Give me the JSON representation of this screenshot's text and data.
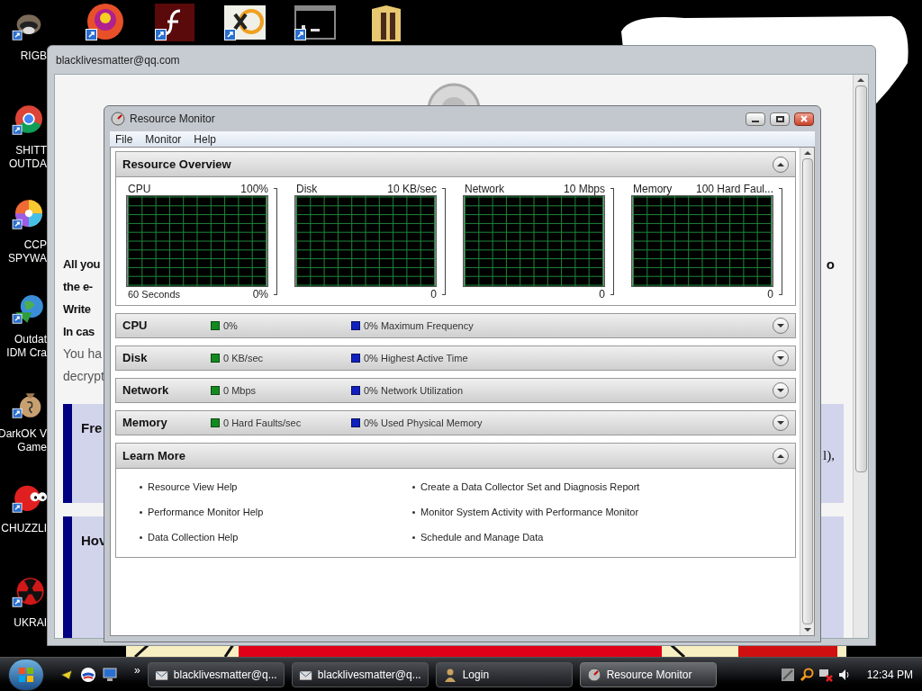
{
  "desktop_icons_left": [
    {
      "kind": "raccoon",
      "label": [
        "RIGB"
      ]
    },
    {
      "kind": "chrome",
      "label": [
        "SHITT",
        "OUTDA"
      ]
    },
    {
      "kind": "pinwheel",
      "label": [
        "CCP",
        "SPYWA"
      ]
    },
    {
      "kind": "globe",
      "label": [
        "Outdat",
        "IDM Cra"
      ]
    },
    {
      "kind": "moneybag",
      "label": [
        "DarkOK V",
        "Game"
      ]
    },
    {
      "kind": "furball",
      "label": [
        "CHUZZLI"
      ]
    },
    {
      "kind": "radiation",
      "label": [
        "UKRAI"
      ]
    }
  ],
  "desktop_icons_top": [
    {
      "kind": "ball"
    },
    {
      "kind": "flash"
    },
    {
      "kind": "hexeditor"
    },
    {
      "kind": "console"
    },
    {
      "kind": "folder"
    }
  ],
  "background_window": {
    "title": "blacklivesmatter@qq.com",
    "lines": [
      {
        "text": "All you",
        "kind": "heading"
      },
      {
        "text": "the e-",
        "kind": "heading"
      },
      {
        "text": "Write",
        "kind": "heading"
      },
      {
        "text": "In cas",
        "kind": "heading"
      },
      {
        "text": "You ha",
        "kind": "body"
      },
      {
        "text": "decrypt",
        "kind": "body"
      }
    ],
    "right_fragment": "o",
    "boxes": [
      {
        "heading": "Fre",
        "right_fragment": "l),"
      },
      {
        "heading": "Hov"
      }
    ]
  },
  "resource_monitor": {
    "title": "Resource Monitor",
    "menu": [
      "File",
      "Monitor",
      "Help"
    ],
    "overview": {
      "title": "Resource Overview",
      "expanded": true,
      "graphs": [
        {
          "name": "CPU",
          "scale": "100%",
          "time": "60 Seconds",
          "minimum": "0%"
        },
        {
          "name": "Disk",
          "scale": "10 KB/sec",
          "minimum": "0"
        },
        {
          "name": "Network",
          "scale": "10 Mbps",
          "minimum": "0"
        },
        {
          "name": "Memory",
          "scale": "100 Hard Faul...",
          "minimum": "0"
        }
      ]
    },
    "sections": [
      {
        "name": "CPU",
        "expanded": false,
        "green_reading": "0%",
        "blue_reading": "0% Maximum Frequency"
      },
      {
        "name": "Disk",
        "expanded": false,
        "green_reading": "0 KB/sec",
        "blue_reading": "0% Highest Active Time"
      },
      {
        "name": "Network",
        "expanded": false,
        "green_reading": "0 Mbps",
        "blue_reading": "0% Network Utilization"
      },
      {
        "name": "Memory",
        "expanded": false,
        "green_reading": "0 Hard Faults/sec",
        "blue_reading": "0% Used Physical Memory"
      }
    ],
    "learn_more": {
      "title": "Learn More",
      "expanded": true,
      "links": [
        "Resource View Help",
        "Create a Data Collector Set and Diagnosis Report",
        "Performance Monitor Help",
        "Monitor System Activity with Performance Monitor",
        "Data Collection Help",
        "Schedule and Manage Data"
      ]
    }
  },
  "taskbar": {
    "overflow": "»",
    "tasks": [
      {
        "label": "blacklivesmatter@q...",
        "kind": "mail",
        "selected": false
      },
      {
        "label": "blacklivesmatter@q...",
        "kind": "mail",
        "selected": false
      },
      {
        "label": "Login",
        "kind": "user",
        "selected": false
      },
      {
        "label": "Resource Monitor",
        "kind": "monitor",
        "selected": true
      }
    ],
    "clock": "12:34 PM"
  }
}
